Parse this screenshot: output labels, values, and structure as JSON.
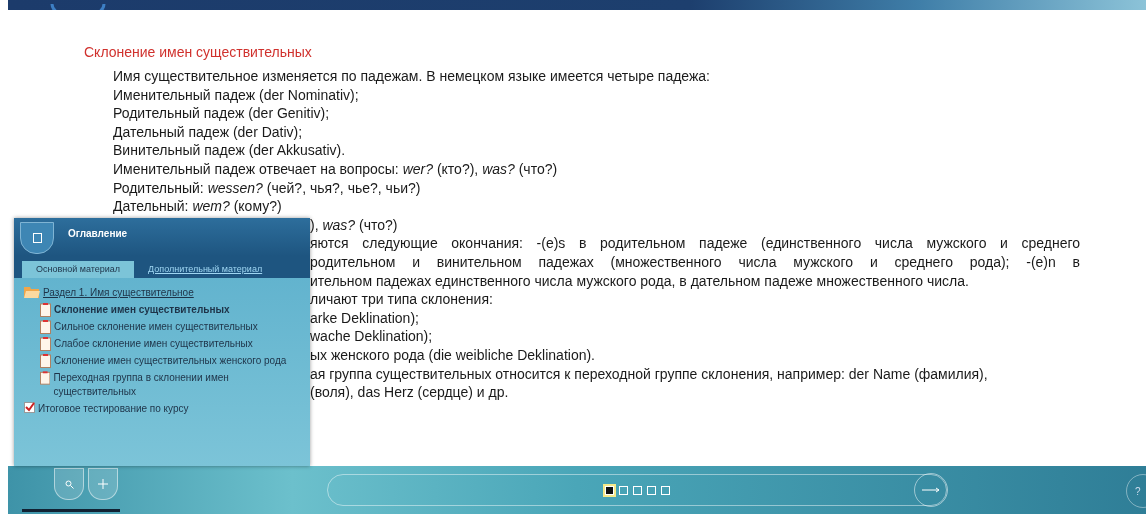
{
  "lesson": {
    "heading": "Склонение имен существительных",
    "lines": [
      {
        "text": "Имя существительное изменяется по падежам. В немецком языке имеется четыре падежа:",
        "covered": false,
        "kind": "plain"
      },
      {
        "text": "Именительный падеж (der Nominativ);",
        "covered": false,
        "kind": "plain"
      },
      {
        "text": "Родительный падеж (der Genitiv);",
        "covered": false,
        "kind": "plain"
      },
      {
        "text": "Дательный падеж (der Dativ);",
        "covered": false,
        "kind": "plain"
      },
      {
        "text": "Винительный падеж (der Akkusativ).",
        "covered": false,
        "kind": "plain"
      },
      {
        "text": "Именительный падеж отвечает на вопросы: *wer?* (кто?), *was?* (что?)",
        "covered": false,
        "kind": "plain"
      },
      {
        "text": "Родительный: *wessen?* (чей?, чья?, чье?, чьи?)",
        "covered": false,
        "kind": "plain"
      },
      {
        "text": "Дательный: *wem?* (кому?)",
        "covered": false,
        "kind": "plain"
      },
      {
        "text": "), *was?* (что?)",
        "covered": true,
        "kind": "plain"
      },
      {
        "text": "яются следующие окончания: -(e)s в родительном падеже (единственного числа мужского и среднего",
        "covered": true,
        "kind": "justified"
      },
      {
        "text": "родительном и винительном падежах (множественного числа мужского и среднего рода); -(e)n в",
        "covered": true,
        "kind": "justified"
      },
      {
        "text": "ительном падежах единственного числа мужского рода, в дательном падеже множественного числа.",
        "covered": true,
        "kind": "plain"
      },
      {
        "text": "личают три типа склонения:",
        "covered": true,
        "kind": "plain"
      },
      {
        "text": "arke Deklination);",
        "covered": true,
        "kind": "plain"
      },
      {
        "text": "wache Deklination);",
        "covered": true,
        "kind": "plain"
      },
      {
        "text": "ых женского рода (die weibliche Deklination).",
        "covered": true,
        "kind": "plain"
      },
      {
        "text": "ая группа существительных относится к переходной группе склонения, например: der Name (фамилия),",
        "covered": true,
        "kind": "plain"
      },
      {
        "text": "(воля), das Herz (сердце) и др.",
        "covered": true,
        "kind": "plain"
      }
    ]
  },
  "toc": {
    "title": "Оглавление",
    "tabs": [
      {
        "label": "Основной материал",
        "selected": true
      },
      {
        "label": "Дополнительный материал",
        "selected": false
      }
    ],
    "items": [
      {
        "label": "Раздел 1. Имя существительное",
        "kind": "folder",
        "selected": false,
        "children": [
          {
            "label": "Склонение имен существительных",
            "kind": "page",
            "selected": true
          },
          {
            "label": "Сильное склонение имен существительных",
            "kind": "page",
            "selected": false
          },
          {
            "label": "Слабое склонение имен существительных",
            "kind": "page",
            "selected": false
          },
          {
            "label": "Склонение имен существительных женского рода",
            "kind": "page",
            "selected": false
          },
          {
            "label": "Переходная группа в склонении имен существительных",
            "kind": "page",
            "selected": false
          }
        ]
      },
      {
        "label": "Итоговое тестирование по курсу",
        "kind": "test",
        "selected": false
      }
    ]
  },
  "player": {
    "pages": [
      {
        "selected": true
      },
      {
        "selected": false
      },
      {
        "selected": false
      },
      {
        "selected": false
      },
      {
        "selected": false
      }
    ],
    "help": "?"
  }
}
